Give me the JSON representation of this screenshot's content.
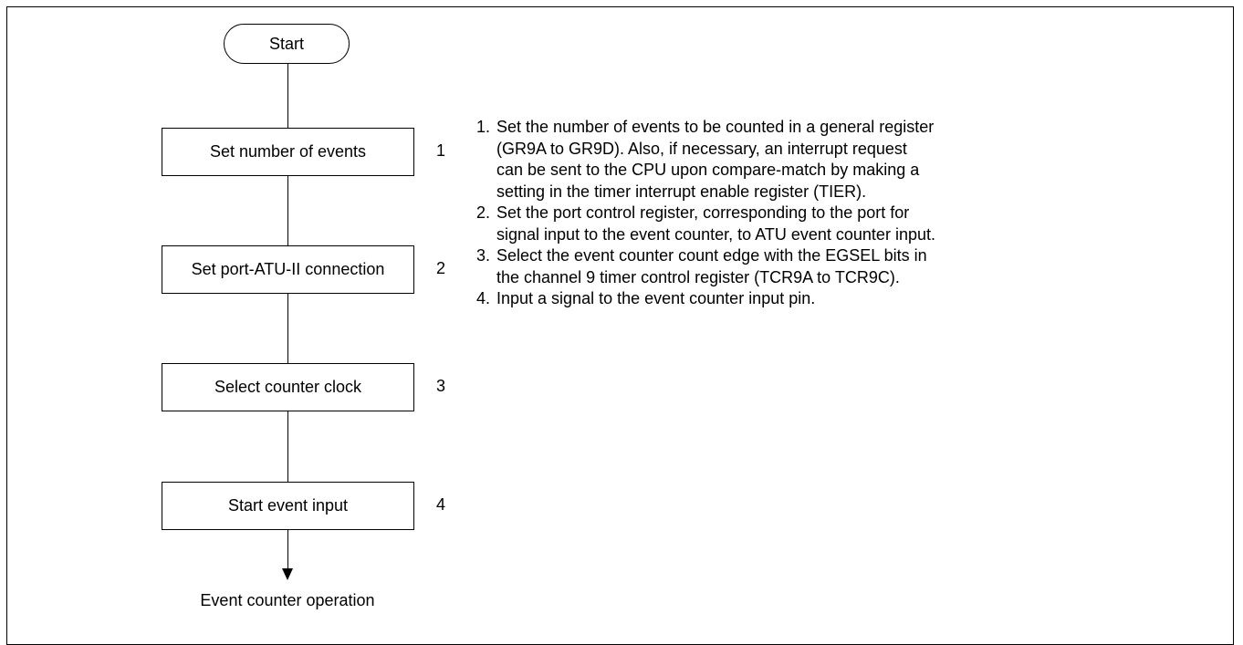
{
  "flowchart": {
    "start_label": "Start",
    "steps": [
      {
        "label": "Set number of events",
        "number": "1"
      },
      {
        "label": "Set port-ATU-II connection",
        "number": "2"
      },
      {
        "label": "Select counter clock",
        "number": "3"
      },
      {
        "label": "Start event input",
        "number": "4"
      }
    ],
    "end_label": "Event counter operation"
  },
  "notes": [
    {
      "number": "1.",
      "text": "Set the number of events to be counted in a general register\n(GR9A to GR9D).  Also, if necessary, an interrupt request\ncan be sent to the CPU upon compare-match by making a\nsetting in the timer interrupt enable register (TIER)."
    },
    {
      "number": "2.",
      "text": "Set the port control register, corresponding to the port for\nsignal input to the event counter, to ATU event counter input."
    },
    {
      "number": "3.",
      "text": "Select the event counter count edge with the EGSEL bits in\nthe channel 9 timer control register (TCR9A to TCR9C)."
    },
    {
      "number": "4.",
      "text": "Input a signal to the event counter input pin."
    }
  ]
}
